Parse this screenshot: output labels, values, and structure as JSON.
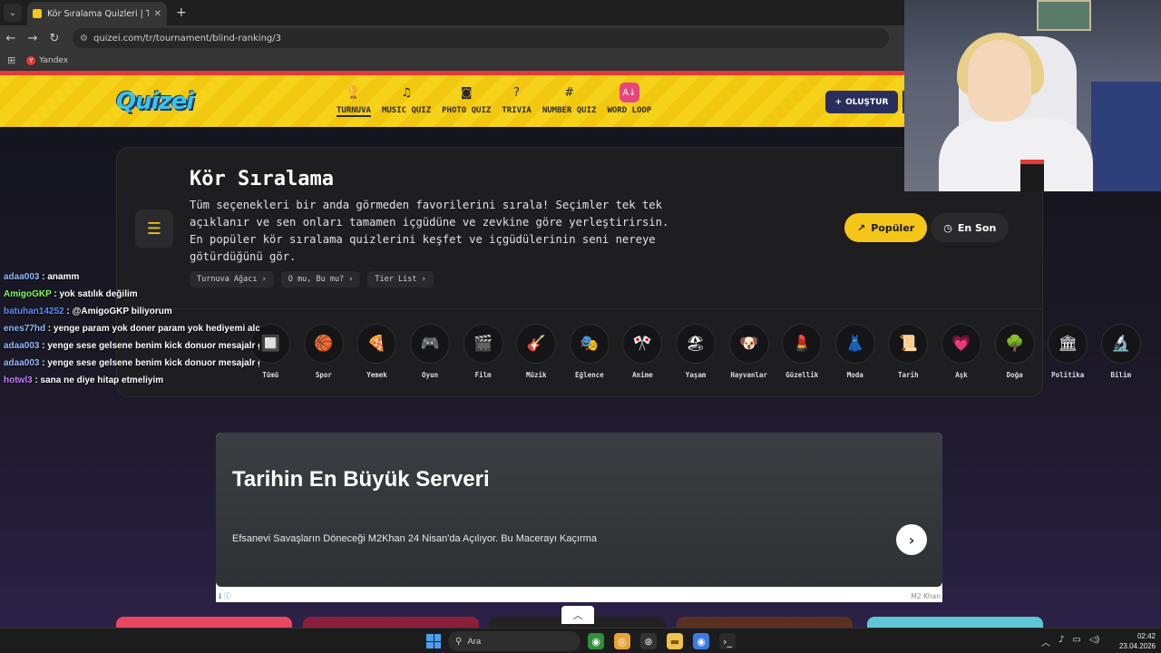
{
  "browser": {
    "tab_title": "Kör Sıralama Quizleri | Turnuva",
    "tab_close": "✕",
    "new_tab": "+",
    "url": "quizei.com/tr/tournament/blind-ranking/3",
    "bookmark": "Yandex"
  },
  "site": {
    "logo": "Quizei",
    "nav": [
      {
        "label": "TURNUVA",
        "icon": "trophy-icon"
      },
      {
        "label": "MUSIC QUIZ",
        "icon": "music-icon"
      },
      {
        "label": "PHOTO QUIZ",
        "icon": "camera-icon"
      },
      {
        "label": "TRIVIA",
        "icon": "question-icon"
      },
      {
        "label": "NUMBER QUIZ",
        "icon": "hash-icon"
      },
      {
        "label": "WORD LOOP",
        "icon": "word-loop-icon"
      }
    ],
    "create_label": "OLUŞTUR"
  },
  "hero": {
    "title": "Kör Sıralama",
    "description": "Tüm seçenekleri bir anda görmeden favorilerini sırala! Seçimler tek tek açıklanır ve sen onları tamamen içgüdüne ve zevkine göre yerleştirirsin. En popüler kör sıralama quizlerini keşfet ve içgüdülerinin seni nereye götürdüğünü gör.",
    "links": [
      "Turnuva Ağacı ›",
      "O mu, Bu mu? ›",
      "Tier List ›"
    ],
    "sort_popular": "Popüler",
    "sort_newest": "En Son",
    "categories": [
      {
        "label": "Tümü",
        "icon": "🔲"
      },
      {
        "label": "Spor",
        "icon": "🏀"
      },
      {
        "label": "Yemek",
        "icon": "🍕"
      },
      {
        "label": "Oyun",
        "icon": "🎮"
      },
      {
        "label": "Film",
        "icon": "🎬"
      },
      {
        "label": "Müzik",
        "icon": "🎸"
      },
      {
        "label": "Eğlence",
        "icon": "🎭"
      },
      {
        "label": "Anime",
        "icon": "🎌"
      },
      {
        "label": "Yaşam",
        "icon": "🏖"
      },
      {
        "label": "Hayvanlar",
        "icon": "🐶"
      },
      {
        "label": "Güzellik",
        "icon": "💄"
      },
      {
        "label": "Moda",
        "icon": "👗"
      },
      {
        "label": "Tarih",
        "icon": "📜"
      },
      {
        "label": "Aşk",
        "icon": "💗"
      },
      {
        "label": "Doğa",
        "icon": "🌳"
      },
      {
        "label": "Politika",
        "icon": "🏛"
      },
      {
        "label": "Bilim",
        "icon": "🔬"
      }
    ]
  },
  "chat": [
    {
      "user": "adaa003",
      "color": "#8fb8ff",
      "message": ": anamm"
    },
    {
      "user": "AmigoGKP",
      "color": "#7cff5a",
      "message": ": yok satılık değilim"
    },
    {
      "user": "batuhan14252",
      "color": "#5a8dff",
      "message": ": @AmigoGKP biliyorum"
    },
    {
      "user": "enes77hd",
      "color": "#8fb8ff",
      "message": ": yenge param yok doner param yok hediyemi alca"
    },
    {
      "user": "adaa003",
      "color": "#8fb8ff",
      "message": ": yenge sese gelsene benim kick donuor mesajalr g"
    },
    {
      "user": "adaa003",
      "color": "#8fb8ff",
      "message": ": yenge sese gelsene benim kick donuor mesajalr g"
    },
    {
      "user": "hotwl3",
      "color": "#c77dff",
      "message": ": sana ne diye hitap etmeliyim"
    }
  ],
  "ad": {
    "title": "Tarihin En Büyük Serveri",
    "text": "Efsanevi Savaşların Döneceği M2Khan 24 Nisan'da Açılıyor. Bu Macerayı Kaçırma",
    "brand": "M2 Khan",
    "info": "ℹ ⓘ"
  },
  "taskbar": {
    "search": "Ara",
    "time": "02:42",
    "date": "23.04.2026"
  },
  "colors": {
    "accent_yellow": "#f5c518",
    "header_stripe": "#e53935",
    "nav_dark": "#2a2e5c"
  }
}
